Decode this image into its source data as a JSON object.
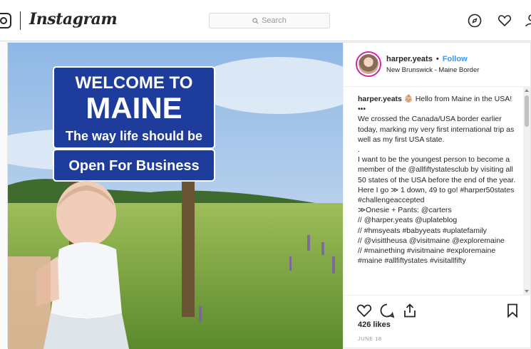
{
  "app": {
    "logo_text": "Instagram"
  },
  "search": {
    "placeholder": "Search"
  },
  "nav": {
    "icons": [
      "compass-icon",
      "heart-icon",
      "profile-icon"
    ]
  },
  "sign": {
    "line1": "WELCOME TO",
    "line2": "MAINE",
    "line3": "The way life should be",
    "line4": "Open For Business"
  },
  "post": {
    "username": "harper.yeats",
    "follow_label": "Follow",
    "separator": "•",
    "location": "New Brunswick - Maine Border",
    "caption_user": "harper.yeats",
    "caption_first": "👶🏼 Hello from Maine in the USA!",
    "caption_lines": [
      "•••",
      "We crossed the Canada/USA border earlier today, marking my very first international trip as well as my first USA state.",
      ".",
      "I want to be the youngest person to become a member of the @allfiftystatesclub by visiting all 50 states of the USA before the end of the year. Here I go ≫ 1 down, 49 to go! #harper50states #challengeaccepted",
      "≫Onesie + Pants: @carters",
      "// @harper.yeats @uplateblog",
      "// #hmsyeats #babyyeats #uplatefamily",
      "// @visittheusa @visitmaine @exploremaine",
      "// #mainething #visitmaine #exploremaine #maine #allfiftystates #visitallfifty"
    ],
    "likes": "426 likes",
    "date": "JUNE 18"
  },
  "colors": {
    "link": "#3897f0",
    "sign_blue": "#1e3c9b",
    "hashtag": "#003569"
  }
}
